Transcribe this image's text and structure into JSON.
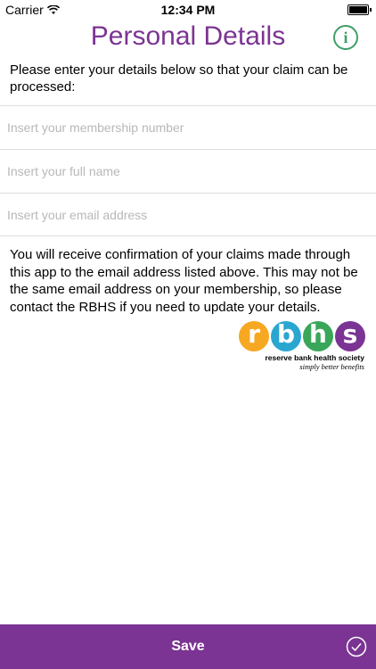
{
  "status_bar": {
    "carrier": "Carrier",
    "time": "12:34 PM"
  },
  "header": {
    "title": "Personal Details",
    "info_icon": "info-icon",
    "info_glyph": "i"
  },
  "intro_text": "Please enter your details below so that your claim can be processed:",
  "form": {
    "membership_placeholder": "Insert your membership number",
    "name_placeholder": "Insert your full name",
    "email_placeholder": "Insert your email address",
    "membership_value": "",
    "name_value": "",
    "email_value": ""
  },
  "confirmation_text": "You will receive confirmation of your claims made through this app to the email address listed above. This may not be the same email address on your membership, so please contact the RBHS if you need to update your details.",
  "logo": {
    "letters": [
      "r",
      "b",
      "h",
      "s"
    ],
    "name": "reserve bank health society",
    "tagline": "simply better benefits"
  },
  "footer": {
    "save_label": "Save",
    "check_icon": "checkmark-circle-icon"
  },
  "colors": {
    "brand_purple": "#7b3493",
    "info_green": "#3f9f69",
    "logo_r": "#f7a823",
    "logo_b": "#29a7d1",
    "logo_h": "#3aa659",
    "logo_s": "#7b3493"
  }
}
